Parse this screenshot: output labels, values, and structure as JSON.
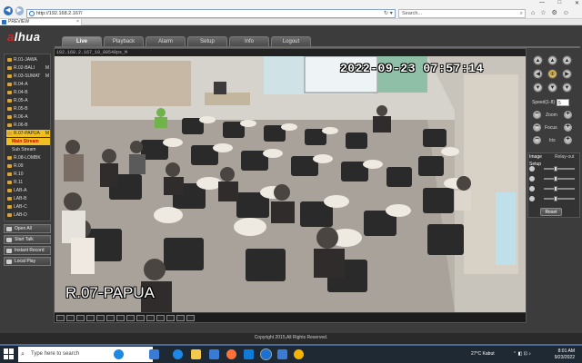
{
  "browser": {
    "url": "http://192.168.2.167/",
    "search_placeholder": "Search...",
    "tab_title": "PREVIEW",
    "tab_close": "×",
    "window_controls": [
      "—",
      "□",
      "✕"
    ],
    "back_glyph": "◀",
    "forward_glyph": "▶",
    "refresh_glyph": "↻ ▾",
    "search_glyph": "⌕",
    "toolbar_icons": [
      "home-icon",
      "star-icon",
      "gear-icon",
      "smiley-icon"
    ],
    "toolbar_glyphs": [
      "⌂",
      "☆",
      "⚙",
      "☺"
    ]
  },
  "app": {
    "logo": {
      "prefix": "a",
      "rest": "lhua"
    },
    "tabs": [
      {
        "label": "Live",
        "active": true
      },
      {
        "label": "Playback",
        "active": false
      },
      {
        "label": "Alarm",
        "active": false
      },
      {
        "label": "Setup",
        "active": false
      },
      {
        "label": "Info",
        "active": false
      },
      {
        "label": "Logout",
        "active": false
      }
    ],
    "channels": [
      {
        "label": "R.01-JAWA",
        "m": ""
      },
      {
        "label": "R.02-BALI",
        "m": "M"
      },
      {
        "label": "R.03-SUMAT",
        "m": "M"
      },
      {
        "label": "R.04-A",
        "m": ""
      },
      {
        "label": "R.04-B",
        "m": ""
      },
      {
        "label": "R.05-A",
        "m": ""
      },
      {
        "label": "R.05-B",
        "m": ""
      },
      {
        "label": "R.06-A",
        "m": ""
      },
      {
        "label": "R.06-B",
        "m": ""
      },
      {
        "label": "R.07-PAPUA",
        "m": "M",
        "selected": true
      },
      {
        "label": "Main Stream",
        "m": "",
        "stream": "main"
      },
      {
        "label": "Sub Stream",
        "m": "",
        "stream": "sub"
      },
      {
        "label": "R.08-LOMBK",
        "m": ""
      },
      {
        "label": "R.09",
        "m": ""
      },
      {
        "label": "R.10",
        "m": ""
      },
      {
        "label": "R.11",
        "m": ""
      },
      {
        "label": "LAB-A",
        "m": ""
      },
      {
        "label": "LAB-B",
        "m": ""
      },
      {
        "label": "LAB-C",
        "m": ""
      },
      {
        "label": "LAB-D",
        "m": ""
      }
    ],
    "side_actions": [
      "Open All",
      "Start Talk",
      "Instant Record",
      "Local Play"
    ],
    "video": {
      "header": "192.168.2.167_10_80540ps_M",
      "osd_time": "2022-09-23 07:57:14",
      "osd_name": "R.07-PAPUA"
    },
    "ptz": {
      "speed_label": "Speed(1-8)",
      "speed_value": "5",
      "zoom_label": "Zoom",
      "focus_label": "Focus",
      "iris_label": "Iris",
      "minus": "−",
      "plus": "+",
      "dir_glyphs": [
        "▲",
        "▲",
        "▲",
        "◀",
        "⊕",
        "▶",
        "▼",
        "▼",
        "▼"
      ]
    },
    "image_setup": {
      "tab1": "Image Setup",
      "tab2": "Relay-out",
      "reset_label": "Reset",
      "sliders": [
        0.35,
        0.35,
        0.35,
        0.35
      ]
    },
    "copyright": "Copyright 2015,All Rights Reserved."
  },
  "taskbar": {
    "search_placeholder": "Type here to search",
    "search_glyph": "⌕",
    "weather": "27°C  Kabut",
    "tray_glyphs": "⌃ ◧ ⊡ ♪",
    "time": "8:01 AM",
    "date": "9/23/2022",
    "colors": {
      "edge": "#1e88e5",
      "chrome": "#f4b400",
      "files": "#f2c94c",
      "store": "#3a7bd5",
      "firefox": "#ff7139",
      "ie": "#1e6fd2",
      "mail": "#0f7bd8"
    }
  }
}
